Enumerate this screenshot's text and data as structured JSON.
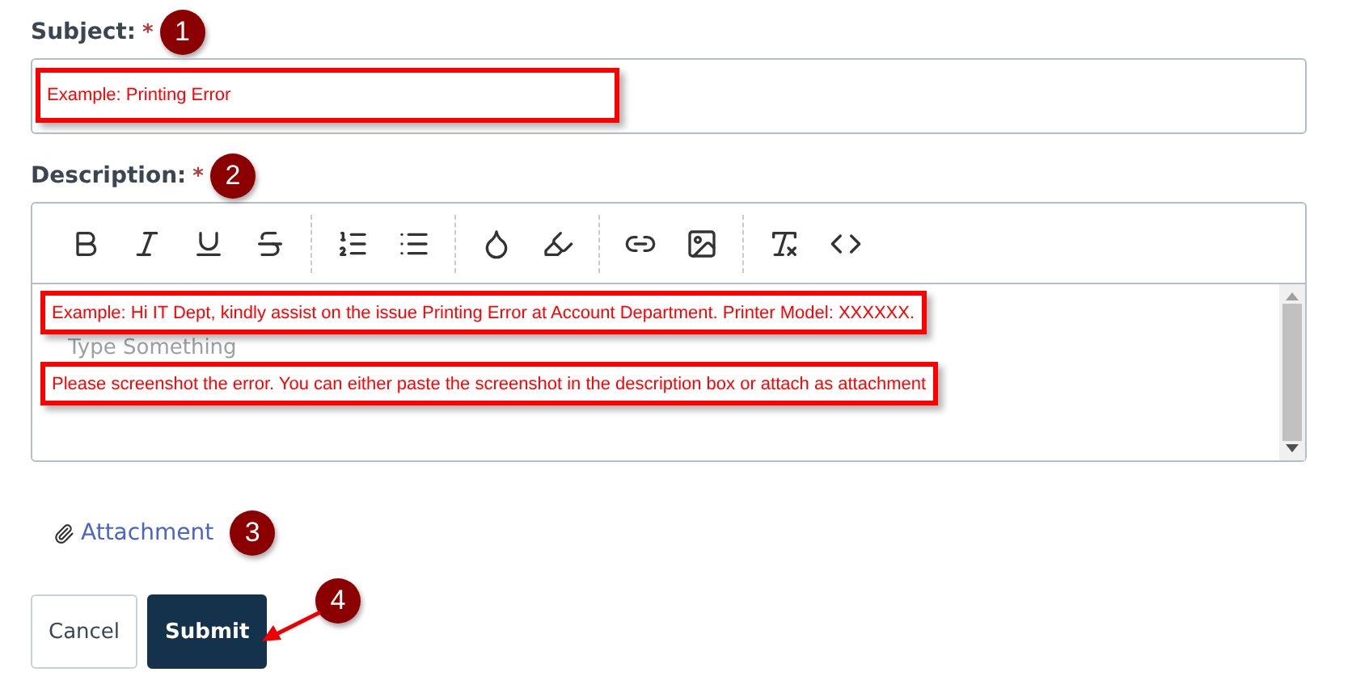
{
  "subject": {
    "label": "Subject:",
    "required": "*",
    "badge": "1",
    "callout": "Example: Printing Error"
  },
  "description": {
    "label": "Description:",
    "required": "*",
    "badge": "2",
    "placeholder": "Type Something",
    "toolbar": [
      [
        {
          "kind": "bold"
        },
        {
          "kind": "italic"
        },
        {
          "kind": "underline"
        },
        {
          "kind": "strike"
        }
      ],
      [
        {
          "kind": "ordered-list"
        },
        {
          "kind": "bullet-list"
        }
      ],
      [
        {
          "kind": "text-color"
        },
        {
          "kind": "highlight"
        }
      ],
      [
        {
          "kind": "link"
        },
        {
          "kind": "image"
        }
      ],
      [
        {
          "kind": "clear-format"
        },
        {
          "kind": "code"
        }
      ]
    ],
    "callouts": [
      "Example: Hi IT Dept, kindly assist on the issue Printing Error at Account Department. Printer Model: XXXXXX.",
      "Please screenshot the error. You can either paste the screenshot in the description box or attach as attachment"
    ]
  },
  "attachment": {
    "label": "Attachment",
    "badge": "3"
  },
  "buttons": [
    {
      "label": "Cancel",
      "kind": "secondary"
    },
    {
      "label": "Submit",
      "kind": "primary"
    }
  ],
  "submit_badge": "4"
}
